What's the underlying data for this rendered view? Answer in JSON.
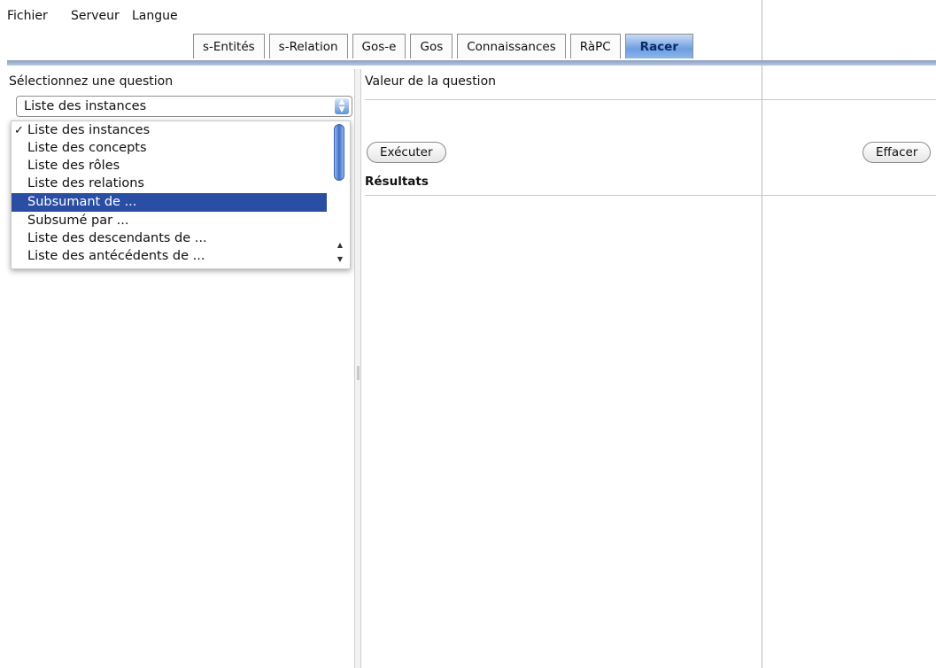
{
  "menu": [
    "Fichier",
    "Serveur",
    "Langue"
  ],
  "tabs": [
    "s-Entités",
    "s-Relation",
    "Gos-e",
    "Gos",
    "Connaissances",
    "RàPC",
    "Racer"
  ],
  "active_tab": "Racer",
  "left": {
    "question_label": "Sélectionnez une question",
    "combo_value": "Liste des instances",
    "options": [
      "Liste des instances",
      "Liste des concepts",
      "Liste des rôles",
      "Liste des relations",
      "Subsumant de ...",
      "Subsumé par ...",
      "Liste des descendants de ...",
      "Liste des antécédents de ..."
    ],
    "checked_index": 0,
    "highlighted_index": 4
  },
  "right": {
    "value_label": "Valeur de la question",
    "execute_label": "Exécuter",
    "clear_label": "Effacer",
    "results_label": "Résultats"
  }
}
